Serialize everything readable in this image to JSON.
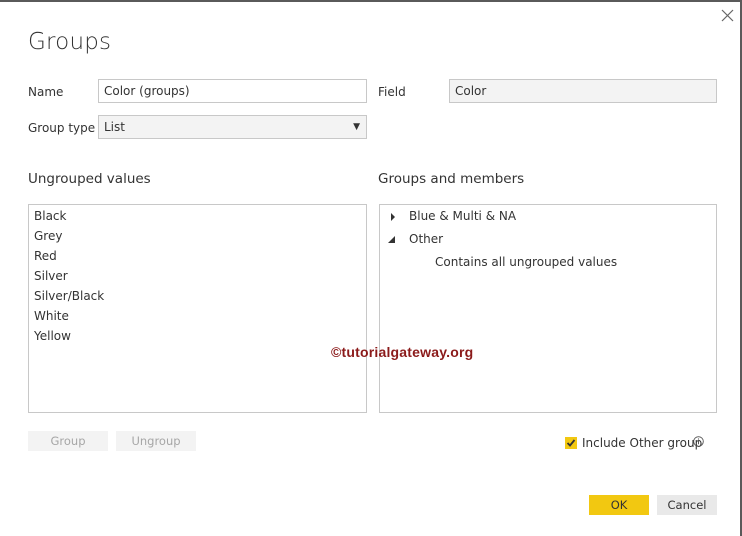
{
  "dialog": {
    "title": "Groups",
    "close_icon": "close-icon"
  },
  "form": {
    "name_label": "Name",
    "name_value": "Color (groups)",
    "field_label": "Field",
    "field_value": "Color",
    "group_type_label": "Group type",
    "group_type_value": "List"
  },
  "ungrouped": {
    "heading": "Ungrouped values",
    "items": [
      "Black",
      "Grey",
      "Red",
      "Silver",
      "Silver/Black",
      "White",
      "Yellow"
    ]
  },
  "groups": {
    "heading": "Groups and members",
    "items": [
      {
        "label": "Blue & Multi & NA",
        "expanded": false
      },
      {
        "label": "Other",
        "expanded": true,
        "note": "Contains all ungrouped values"
      }
    ]
  },
  "watermark": "©tutorialgateway.org",
  "buttons": {
    "group": "Group",
    "ungroup": "Ungroup",
    "ok": "OK",
    "cancel": "Cancel"
  },
  "include_other": {
    "label": "Include Other group",
    "checked": true
  },
  "colors": {
    "accent": "#f2c811",
    "border": "#c8c8c8",
    "watermark": "#8b1a1a"
  }
}
